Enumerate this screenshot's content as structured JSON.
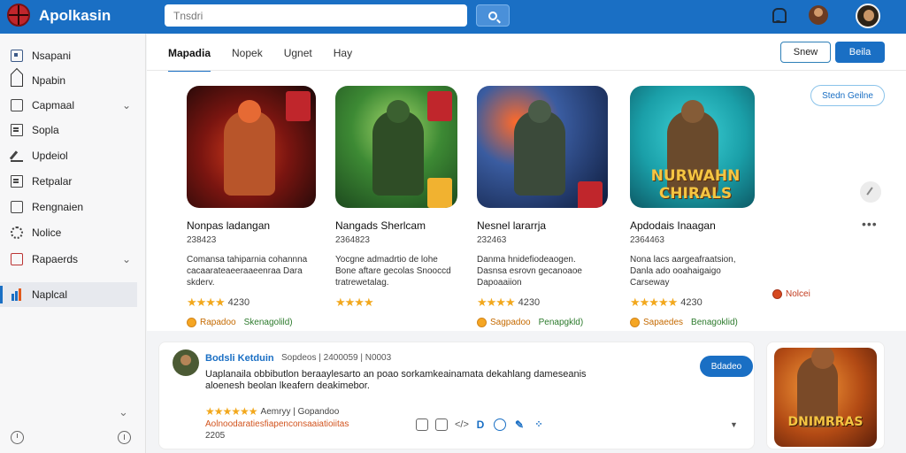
{
  "header": {
    "app_title": "Apolkasin",
    "search_placeholder": "Tnsdri"
  },
  "sidebar": {
    "items": [
      {
        "label": "Nsapani",
        "icon": "grid-icon"
      },
      {
        "label": "Npabin",
        "icon": "car-icon"
      },
      {
        "label": "Capmaal",
        "icon": "box-icon",
        "expandable": true
      },
      {
        "label": "Sopla",
        "icon": "document-icon"
      },
      {
        "label": "Updeiol",
        "icon": "pencil-icon"
      },
      {
        "label": "Retpalar",
        "icon": "document-icon"
      },
      {
        "label": "Rengnaien",
        "icon": "chart-icon"
      },
      {
        "label": "Nolice",
        "icon": "gear-icon"
      },
      {
        "label": "Rapaerds",
        "icon": "gift-icon",
        "expandable": true
      },
      {
        "label": "Naplcal",
        "icon": "bars-icon",
        "active": true
      }
    ]
  },
  "main": {
    "tabs": [
      {
        "label": "Mapadia",
        "active": true
      },
      {
        "label": "Nopek"
      },
      {
        "label": "Ugnet"
      },
      {
        "label": "Hay"
      }
    ],
    "buttons": {
      "outline": "Snew",
      "primary": "Beila",
      "pill": "Stedn Geilne"
    },
    "games": [
      {
        "title": "Nonpas ladangan",
        "code": "238423",
        "description": "Comansa tahiparnia cohannna cacaarateaeeraaeenraa Dara skderv.",
        "rating_value": "4230",
        "badge_primary": "Rapadoo",
        "badge_secondary": "Skenagolild)",
        "logo_text": ""
      },
      {
        "title": "Nangads Sherlcam",
        "code": "2364823",
        "description": "Yocgne admadrtio de lohe Bone aftare gecolas Snooccd tratrewetalag.",
        "rating_value": "",
        "badge_primary": "",
        "badge_secondary": "",
        "logo_text": ""
      },
      {
        "title": "Nesnel lararrja",
        "code": "232463",
        "description": "Danma hnidefiodeaogen. Dasnsa esrovn gecanoaoe Dapoaaiion",
        "rating_value": "4230",
        "badge_primary": "Sagpadoo",
        "badge_secondary": "Penapgkld)",
        "logo_text": ""
      },
      {
        "title": "Apdodais Inaagan",
        "code": "2364463",
        "description": "Nona lacs aargeafraatsion, Danla ado ooahaigaigo Carseway",
        "rating_value": "4230",
        "badge_primary": "Sapaedes",
        "badge_secondary": "Benagoklid)",
        "logo_text": "NURWAHN CHIRALS"
      }
    ],
    "side_badge": "Nolcei"
  },
  "review": {
    "name": "Bodsli Ketduin",
    "meta": "Sopdeos | 2400059 | N0003",
    "text": "Uaplanaila obbibutlon beraaylesarto an poao sorkamkeainamata dekahlang dameseanis aloenesh beolan lkeafern deakimebor.",
    "rating_label": "Aemryy | Gopandoo",
    "promo": "Aolnoodaratiesfiapenconsaaiatioiitas",
    "count": "2205",
    "follow_button": "Bdadeo"
  },
  "promo_tile": {
    "logo_text": "DNIMRRAS"
  },
  "colors": {
    "accent": "#1a6fc4",
    "star": "#f2a81d",
    "promo": "#d2541e"
  }
}
